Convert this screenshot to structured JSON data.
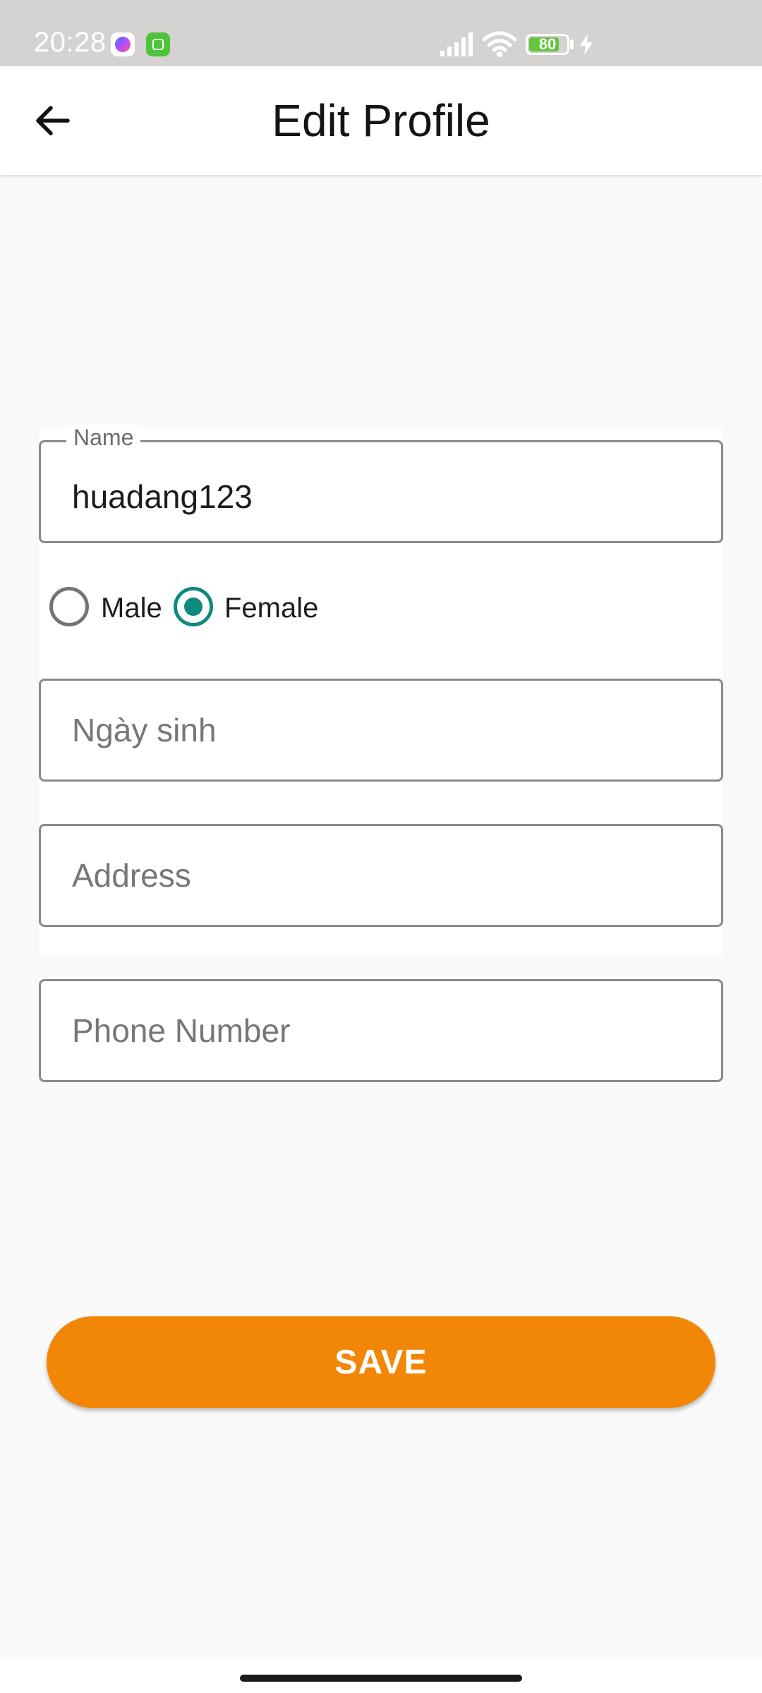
{
  "status_bar": {
    "time": "20:28",
    "battery_level": "80",
    "notification_icons": [
      "messenger-icon",
      "game-app-icon"
    ],
    "system_icons": [
      "signal-icon",
      "wifi-icon",
      "battery-icon",
      "charging-bolt-icon"
    ]
  },
  "app_bar": {
    "title": "Edit Profile",
    "back_icon": "arrow-left-icon"
  },
  "form": {
    "name": {
      "label": "Name",
      "value": "huadang123"
    },
    "gender": {
      "options": [
        {
          "label": "Male",
          "selected": false
        },
        {
          "label": "Female",
          "selected": true
        }
      ]
    },
    "birthday": {
      "placeholder": "Ngày sinh",
      "value": ""
    },
    "address": {
      "placeholder": "Address",
      "value": ""
    },
    "phone": {
      "placeholder": "Phone Number",
      "value": ""
    }
  },
  "actions": {
    "save_label": "SAVE"
  },
  "colors": {
    "accent_radio": "#0d8a7c",
    "save_button": "#f28606",
    "status_bar": "#d5d2d2",
    "background": "#f9f9f9"
  }
}
